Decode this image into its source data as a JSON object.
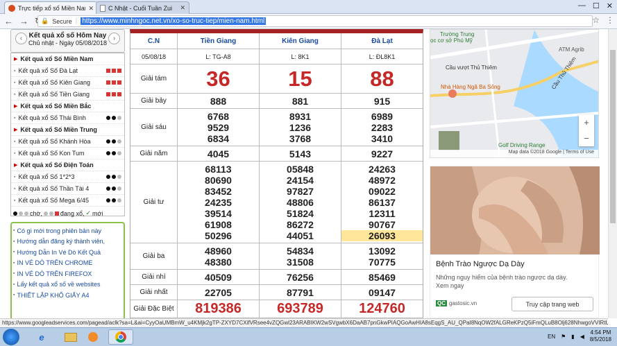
{
  "browser": {
    "tabs": [
      {
        "title": "Trực tiếp xổ số Miền Nam"
      },
      {
        "title": "C Nhật - Cuối Tuần Zui"
      }
    ],
    "secure_label": "Secure",
    "url": "https://www.minhngoc.net.vn/xo-so-truc-tiep/mien-nam.html"
  },
  "sidebar": {
    "heading": "Kết quả xổ số Hôm Nay",
    "date": "Chủ nhật - Ngày 05/08/2018",
    "menu": [
      {
        "type": "head",
        "label": "Kết quả xổ Số Miền Nam"
      },
      {
        "type": "item",
        "label": "Kết quả xổ Số Đà Lạt",
        "dots": [
          "red",
          "red",
          "red"
        ]
      },
      {
        "type": "item",
        "label": "Kết quả xổ Số Kiên Giang",
        "dots": [
          "red",
          "red",
          "red"
        ]
      },
      {
        "type": "item",
        "label": "Kết quả xổ Số Tiền Giang",
        "dots": [
          "red",
          "red",
          "red"
        ]
      },
      {
        "type": "head",
        "label": "Kết quả xổ Số Miền Bắc"
      },
      {
        "type": "item",
        "label": "Kết quả xổ Số Thái Bình",
        "dots": [
          "blk",
          "blk",
          "gry"
        ]
      },
      {
        "type": "head",
        "label": "Kết quả xổ Số Miền Trung"
      },
      {
        "type": "item",
        "label": "Kết quả xổ Số Khánh Hòa",
        "dots": [
          "blk",
          "blk",
          "gry"
        ]
      },
      {
        "type": "item",
        "label": "Kết quả xổ Số Kon Tum",
        "dots": [
          "blk",
          "blk",
          "gry"
        ]
      },
      {
        "type": "head",
        "label": "Kết quả xổ Số Điện Toán"
      },
      {
        "type": "item",
        "label": "Kết quả xổ Số 1*2*3",
        "dots": [
          "blk",
          "blk",
          "gry"
        ]
      },
      {
        "type": "item",
        "label": "Kết quả xổ Số Thần Tài 4",
        "dots": [
          "blk",
          "blk",
          "gry"
        ]
      },
      {
        "type": "item",
        "label": "Kết quả xổ Số Mega 6/45",
        "dots": [
          "blk",
          "blk",
          "gry"
        ]
      }
    ],
    "legend": {
      "waiting": "chờ,",
      "running": "đang xổ,",
      "new": "mới"
    },
    "links": [
      "Có gì mới trong phiên bản này",
      "Hướng dẫn đăng ký thành viên,",
      "Hướng Dẫn In Vé Dò Kết Quả",
      "IN VÉ DÒ TRÊN CHROME",
      "IN VÉ DÒ TRÊN FIREFOX",
      "Lấy kết quả xổ số về websites",
      "THIẾT LẬP KHỔ GIẤY A4"
    ]
  },
  "results": {
    "day": "C.N",
    "date": "05/08/18",
    "provinces": [
      {
        "name": "Tiền Giang",
        "code": "L: TG-A8"
      },
      {
        "name": "Kiên Giang",
        "code": "L: 8K1"
      },
      {
        "name": "Đà Lạt",
        "code": "L: ĐL8K1"
      }
    ],
    "prizes": [
      {
        "name": "Giải tám",
        "style": "big",
        "values": [
          [
            "36"
          ],
          [
            "15"
          ],
          [
            "88"
          ]
        ]
      },
      {
        "name": "Giải bảy",
        "style": "num",
        "values": [
          [
            "888"
          ],
          [
            "881"
          ],
          [
            "915"
          ]
        ]
      },
      {
        "name": "Giải sáu",
        "style": "num",
        "values": [
          [
            "6768",
            "9529",
            "6834"
          ],
          [
            "8931",
            "1236",
            "3768"
          ],
          [
            "6989",
            "2283",
            "3410"
          ]
        ]
      },
      {
        "name": "Giải năm",
        "style": "num",
        "values": [
          [
            "4045"
          ],
          [
            "5143"
          ],
          [
            "9227"
          ]
        ]
      },
      {
        "name": "Giải tư",
        "style": "num",
        "values": [
          [
            "68113",
            "80690",
            "83452",
            "24235",
            "39514",
            "61908",
            "50296"
          ],
          [
            "05848",
            "24154",
            "97827",
            "48806",
            "51824",
            "86272",
            "44051"
          ],
          [
            "24263",
            "48972",
            "09022",
            "86137",
            "12311",
            "90767",
            "26093"
          ]
        ],
        "highlight": "26093"
      },
      {
        "name": "Giải ba",
        "style": "num",
        "values": [
          [
            "48960",
            "48380"
          ],
          [
            "54834",
            "31508"
          ],
          [
            "13092",
            "70775"
          ]
        ]
      },
      {
        "name": "Giải nhì",
        "style": "num",
        "values": [
          [
            "40509"
          ],
          [
            "76256"
          ],
          [
            "85469"
          ]
        ]
      },
      {
        "name": "Giải nhất",
        "style": "num",
        "values": [
          [
            "22705"
          ],
          [
            "87791"
          ],
          [
            "09147"
          ]
        ]
      },
      {
        "name": "Giải Đặc Biệt",
        "style": "dbig",
        "values": [
          [
            "819386"
          ],
          [
            "693789"
          ],
          [
            "124760"
          ]
        ]
      }
    ]
  },
  "map": {
    "labels": [
      "Trường Trung",
      "ọc cơ sở Phú Mỹ",
      "ATM Agrib",
      "Cầu vượt Thủ Thiêm",
      "Cầu Thủ Thiêm",
      "Nhà Hàng Ngã Ba Sông",
      "Golf Driving Range"
    ],
    "footer": "Map data ©2018 Google | Terms of Use"
  },
  "ad": {
    "title": "Bệnh Trào Ngược Dạ Dày",
    "text": "Những nguy hiểm của bệnh trào ngược dạ dày. Xem ngay",
    "badge": "QC",
    "source": "gastosic.vn",
    "button": "Truy cập trang web"
  },
  "status_url": "https://www.googleadservices.com/pagead/aclk?sa=L&ai=CyyOaUMBmW_u4KMjk2gTP-ZXYD7CXifVRsee4vZQGwl23ARABIKW2wSVgwbX6DaAB7pnGkwPIAQGoAwHIA8sEqgS_AU_QPaI8NqOW2fALGReKPzQ5iFmQLuB8Olj628NhwgoVVIRtU01bOtG6HJr...",
  "taskbar": {
    "lang": "EN",
    "time": "4:54 PM",
    "date": "8/5/2018"
  },
  "colors": {
    "accent": "#a52020",
    "link": "#1a4ba0",
    "number_red": "#c62828",
    "highlight": "#ffe699"
  }
}
